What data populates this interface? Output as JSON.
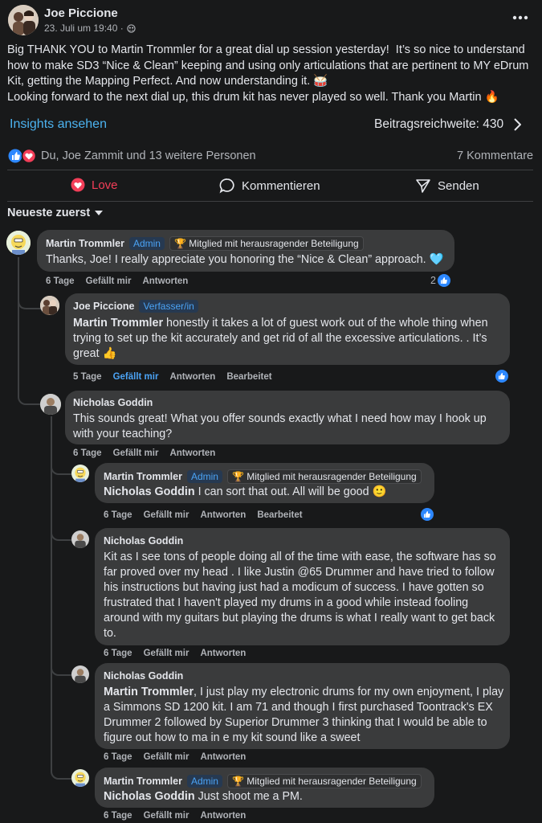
{
  "post": {
    "author": "Joe Piccione",
    "time": "23. Juli um 19:40 ·",
    "text": "Big THANK YOU to Martin Trommler for a great dial up session yesterday!  It’s so nice to understand how to make SD3 “Nice & Clean” keeping and using only articulations that are pertinent to MY eDrum Kit, getting the Mapping Perfect. And now understanding it. 🥁\nLooking forward to the next dial up, this drum kit has never played so well. Thank you Martin 🔥",
    "more_icon": "more-dots-icon"
  },
  "insights": {
    "link": "Insights ansehen",
    "reach": "Beitragsreichweite: 430"
  },
  "reactions": {
    "summary": "Du, Joe Zammit und 13 weitere Personen",
    "comments": "7 Kommentare"
  },
  "actions": {
    "love": "Love",
    "comment": "Kommentieren",
    "send": "Senden"
  },
  "sort": {
    "label": "Neueste zuerst"
  },
  "colors": {
    "accent": "#4ba3f5",
    "love": "#f33e58",
    "bubble": "#3a3b3c",
    "background": "#18191a"
  },
  "comments": [
    {
      "author": "Martin Trommler",
      "badge": "Admin",
      "badge2": "🏆 Mitglied mit herausragender Beteiligung",
      "text": "Thanks, Joe! I really appreciate you honoring the “Nice & Clean” approach. 🩵",
      "age": "6 Tage",
      "like": "Gefällt mir",
      "reply": "Antworten",
      "reaction_count": "2"
    },
    {
      "author": "Joe Piccione",
      "badge": "Verfasser/in",
      "mention": "Martin Trommler",
      "text": " honestly it takes a lot of guest work out of the whole thing when trying to set up the kit accurately and get rid of all the excessive articulations. . It’s great 👍",
      "age": "5 Tage",
      "like": "Gefällt mir",
      "reply": "Antworten",
      "edit": "Bearbeitet"
    },
    {
      "author": "Nicholas Goddin",
      "text": "This sounds great! What you offer sounds exactly what I need how may I hook up with your teaching?",
      "age": "6 Tage",
      "like": "Gefällt mir",
      "reply": "Antworten"
    },
    {
      "author": "Martin Trommler",
      "badge": "Admin",
      "badge2": "🏆 Mitglied mit herausragender Beteiligung",
      "mention": "Nicholas Goddin",
      "text": " I can sort that out. All will be good 🙂",
      "age": "6 Tage",
      "like": "Gefällt mir",
      "reply": "Antworten",
      "edit": "Bearbeitet"
    },
    {
      "author": "Nicholas Goddin",
      "text": "Kit as I see tons of people doing all of the time with ease, the software has so far proved over my head . I like Justin @65 Drummer and have tried to follow his instructions but having just had a modicum of success. I have gotten so frustrated that I haven't played my drums in a good while instead fooling around with my guitars but playing the drums is what I really want to get back to.",
      "age": "6 Tage",
      "like": "Gefällt mir",
      "reply": "Antworten"
    },
    {
      "author": "Nicholas Goddin",
      "mention": "Martin Trommler",
      "text": ", I just play my electronic drums for my own enjoyment, I play a Simmons SD 1200 kit. I am 71 and though I first purchased Toontrack's EX Drummer 2 followed by Superior Drummer 3 thinking that I would be able to figure out how to ma in e my kit sound like a sweet",
      "age": "6 Tage",
      "like": "Gefällt mir",
      "reply": "Antworten"
    },
    {
      "author": "Martin Trommler",
      "badge": "Admin",
      "badge2": "🏆 Mitglied mit herausragender Beteiligung",
      "mention": "Nicholas Goddin",
      "text": " Just shoot me a PM.",
      "age": "6 Tage",
      "like": "Gefällt mir",
      "reply": "Antworten"
    }
  ]
}
